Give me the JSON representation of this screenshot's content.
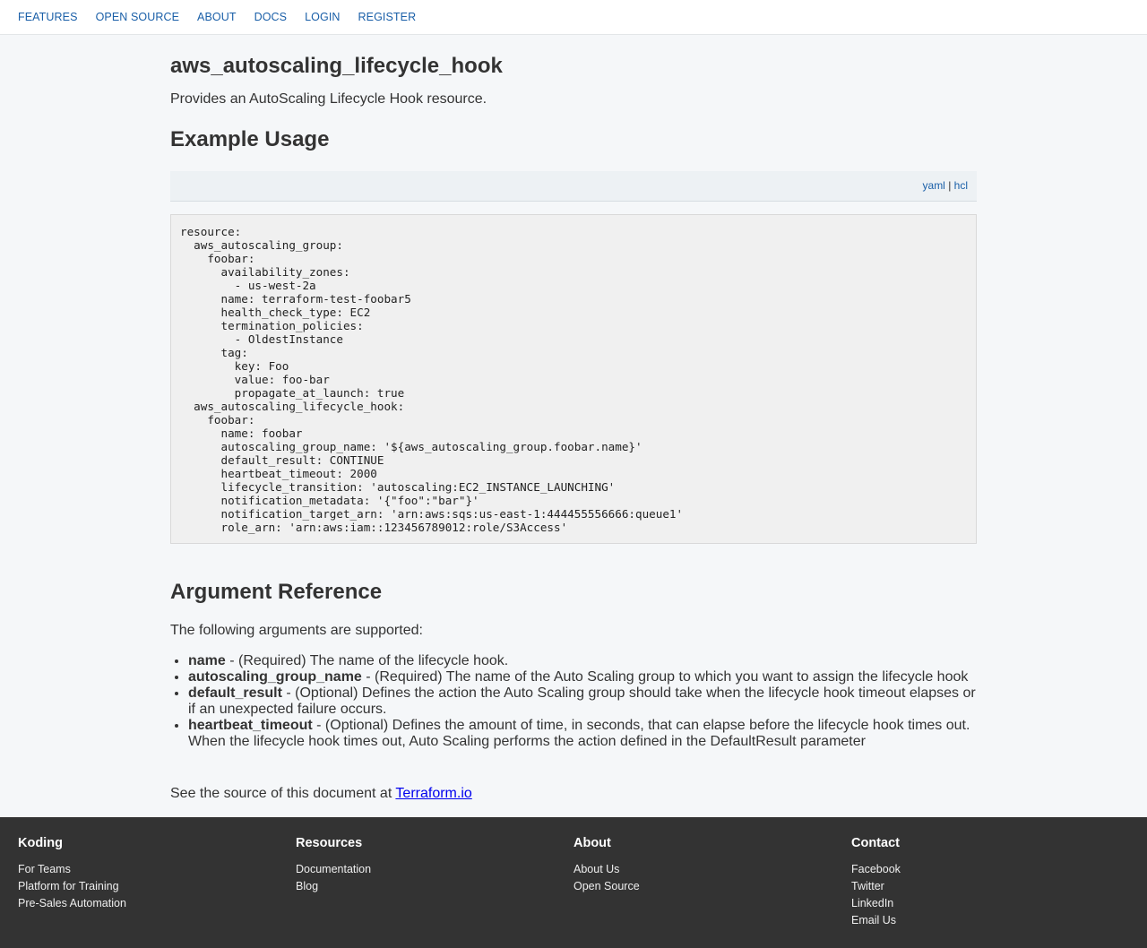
{
  "nav": {
    "items": [
      "FEATURES",
      "OPEN SOURCE",
      "ABOUT",
      "DOCS",
      "LOGIN",
      "REGISTER"
    ]
  },
  "page": {
    "title": "aws_autoscaling_lifecycle_hook",
    "intro": "Provides an AutoScaling Lifecycle Hook resource."
  },
  "example": {
    "heading": "Example Usage",
    "tab_yaml": "yaml",
    "tab_sep": " | ",
    "tab_hcl": "hcl",
    "code": "resource:\n  aws_autoscaling_group:\n    foobar:\n      availability_zones:\n        - us-west-2a\n      name: terraform-test-foobar5\n      health_check_type: EC2\n      termination_policies:\n        - OldestInstance\n      tag:\n        key: Foo\n        value: foo-bar\n        propagate_at_launch: true\n  aws_autoscaling_lifecycle_hook:\n    foobar:\n      name: foobar\n      autoscaling_group_name: '${aws_autoscaling_group.foobar.name}'\n      default_result: CONTINUE\n      heartbeat_timeout: 2000\n      lifecycle_transition: 'autoscaling:EC2_INSTANCE_LAUNCHING'\n      notification_metadata: '{\"foo\":\"bar\"}'\n      notification_target_arn: 'arn:aws:sqs:us-east-1:444455556666:queue1'\n      role_arn: 'arn:aws:iam::123456789012:role/S3Access'"
  },
  "arguments": {
    "heading": "Argument Reference",
    "intro": "The following arguments are supported:",
    "items": [
      {
        "name": "name",
        "desc": " - (Required) The name of the lifecycle hook."
      },
      {
        "name": "autoscaling_group_name",
        "desc": " - (Required) The name of the Auto Scaling group to which you want to assign the lifecycle hook"
      },
      {
        "name": "default_result",
        "desc": " - (Optional) Defines the action the Auto Scaling group should take when the lifecycle hook timeout elapses or if an unexpected failure occurs."
      },
      {
        "name": "heartbeat_timeout",
        "desc": " - (Optional) Defines the amount of time, in seconds, that can elapse before the lifecycle hook times out. When the lifecycle hook times out, Auto Scaling performs the action defined in the DefaultResult parameter"
      }
    ]
  },
  "source": {
    "prefix": "See the source of this document at ",
    "link": "Terraform.io"
  },
  "footer": {
    "columns": [
      {
        "title": "Koding",
        "links": [
          "For Teams",
          "Platform for Training",
          "Pre-Sales Automation"
        ]
      },
      {
        "title": "Resources",
        "links": [
          "Documentation",
          "Blog"
        ]
      },
      {
        "title": "About",
        "links": [
          "About Us",
          "Open Source"
        ]
      },
      {
        "title": "Contact",
        "links": [
          "Facebook",
          "Twitter",
          "LinkedIn",
          "Email Us"
        ]
      }
    ]
  }
}
